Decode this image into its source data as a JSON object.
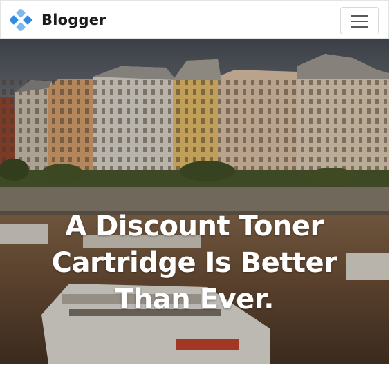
{
  "navbar": {
    "brand_name": "Blogger",
    "logo_icon": "diamond-cluster-logo",
    "menu_icon": "hamburger-menu-icon"
  },
  "hero": {
    "title": "A Discount Toner Cartridge Is Better Than Ever."
  },
  "colors": {
    "logo_blue": "#2f8be6",
    "logo_light": "#7fb8f0",
    "brand_text": "#1c1c1c",
    "hero_text": "#ffffff"
  }
}
